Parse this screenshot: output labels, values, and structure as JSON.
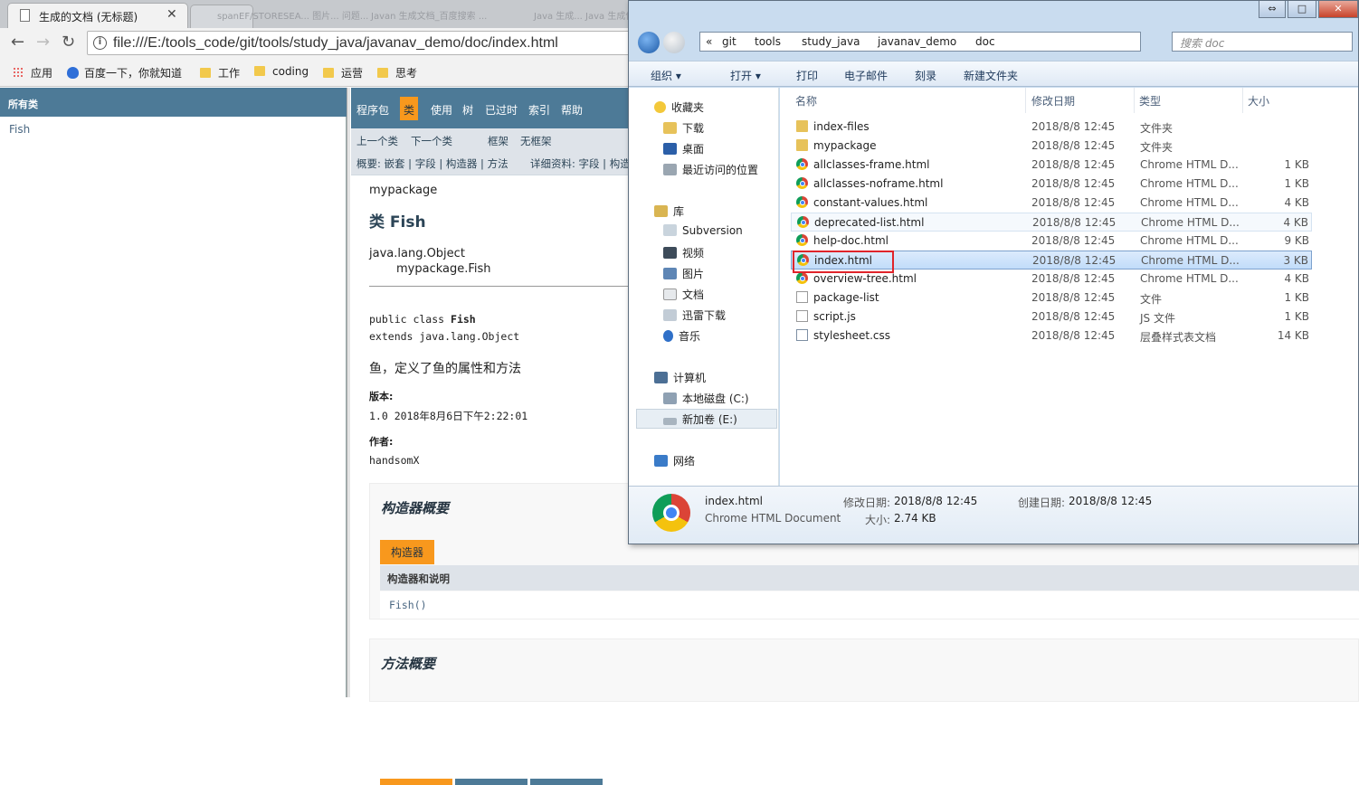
{
  "browser": {
    "tab_title": "生成的文档 (无标题)",
    "tab_close": "✕",
    "faint_tabs": [
      "spanEF/STORESEA... 图片... 问题...",
      "Javan 生成文档_百度搜索 ...",
      "Java 生成... Java 生成使用..."
    ],
    "url": "file:///E:/tools_code/git/tools/study_java/javanav_demo/doc/index.html",
    "bookmarks": [
      {
        "label": "应用",
        "icon": "apps-icon"
      },
      {
        "label": "百度一下，你就知道",
        "icon": "baidu-icon"
      },
      {
        "label": "工作",
        "icon": "folder-icon"
      },
      {
        "label": "coding",
        "icon": "folder-icon"
      },
      {
        "label": "运营",
        "icon": "folder-icon"
      },
      {
        "label": "思考",
        "icon": "folder-icon"
      }
    ]
  },
  "javadoc": {
    "left_header": "所有类",
    "left_classes": [
      "Fish"
    ],
    "nav": [
      "程序包",
      "类",
      "使用",
      "树",
      "已过时",
      "索引",
      "帮助"
    ],
    "active_nav": "类",
    "subnav_row1": [
      "上一个类",
      "下一个类",
      "框架",
      "无框架"
    ],
    "subnav_row2_left": "概要: 嵌套 | 字段 | 构造器 | 方法",
    "subnav_row2_right": "详细资料: 字段 | 构造",
    "package": "mypackage",
    "class_title": "类 Fish",
    "inherit_1": "java.lang.Object",
    "inherit_2": "mypackage.Fish",
    "decl_prefix": "public class ",
    "decl_name": "Fish",
    "decl_extends": "extends java.lang.Object",
    "description": "鱼，定义了鱼的属性和方法",
    "version_label": "版本:",
    "version_value": "1.0 2018年8月6日下午2:22:01",
    "author_label": "作者:",
    "author_value": "handsomX",
    "ctor_section_title": "构造器概要",
    "ctor_caption": "构造器",
    "ctor_table_header": "构造器和说明",
    "ctor_entry": "Fish()",
    "method_section_title": "方法概要"
  },
  "explorer": {
    "breadcrumbs": [
      "«",
      "git",
      "tools",
      "study_java",
      "javanav_demo",
      "doc"
    ],
    "search_placeholder": "搜索 doc",
    "commands": [
      "组织 ▾",
      "打开 ▾",
      "打印",
      "电子邮件",
      "刻录",
      "新建文件夹"
    ],
    "nav_pane": {
      "favorites": {
        "label": "收藏夹",
        "items": [
          "下载",
          "桌面",
          "最近访问的位置"
        ]
      },
      "libraries": {
        "label": "库",
        "items": [
          "Subversion",
          "视频",
          "图片",
          "文档",
          "迅雷下载",
          "音乐"
        ]
      },
      "computer": {
        "label": "计算机",
        "items": [
          "本地磁盘 (C:)",
          "新加卷 (E:)"
        ]
      },
      "network": {
        "label": "网络"
      }
    },
    "columns": [
      "名称",
      "修改日期",
      "类型",
      "大小"
    ],
    "files": [
      {
        "name": "index-files",
        "date": "2018/8/8 12:45",
        "type": "文件夹",
        "size": "",
        "icon": "folder-icon"
      },
      {
        "name": "mypackage",
        "date": "2018/8/8 12:45",
        "type": "文件夹",
        "size": "",
        "icon": "folder-icon"
      },
      {
        "name": "allclasses-frame.html",
        "date": "2018/8/8 12:45",
        "type": "Chrome HTML D...",
        "size": "1 KB",
        "icon": "chrome-icon"
      },
      {
        "name": "allclasses-noframe.html",
        "date": "2018/8/8 12:45",
        "type": "Chrome HTML D...",
        "size": "1 KB",
        "icon": "chrome-icon"
      },
      {
        "name": "constant-values.html",
        "date": "2018/8/8 12:45",
        "type": "Chrome HTML D...",
        "size": "4 KB",
        "icon": "chrome-icon"
      },
      {
        "name": "deprecated-list.html",
        "date": "2018/8/8 12:45",
        "type": "Chrome HTML D...",
        "size": "4 KB",
        "icon": "chrome-icon"
      },
      {
        "name": "help-doc.html",
        "date": "2018/8/8 12:45",
        "type": "Chrome HTML D...",
        "size": "9 KB",
        "icon": "chrome-icon"
      },
      {
        "name": "index.html",
        "date": "2018/8/8 12:45",
        "type": "Chrome HTML D...",
        "size": "3 KB",
        "icon": "chrome-icon"
      },
      {
        "name": "overview-tree.html",
        "date": "2018/8/8 12:45",
        "type": "Chrome HTML D...",
        "size": "4 KB",
        "icon": "chrome-icon"
      },
      {
        "name": "package-list",
        "date": "2018/8/8 12:45",
        "type": "文件",
        "size": "1 KB",
        "icon": "file-icon"
      },
      {
        "name": "script.js",
        "date": "2018/8/8 12:45",
        "type": "JS 文件",
        "size": "1 KB",
        "icon": "js-icon"
      },
      {
        "name": "stylesheet.css",
        "date": "2018/8/8 12:45",
        "type": "层叠样式表文档",
        "size": "14 KB",
        "icon": "css-icon"
      }
    ],
    "selected_file": "index.html",
    "details": {
      "name": "index.html",
      "type": "Chrome HTML Document",
      "modified_label": "修改日期:",
      "modified_value": "2018/8/8 12:45",
      "created_label": "创建日期:",
      "created_value": "2018/8/8 12:45",
      "size_label": "大小:",
      "size_value": "2.74 KB"
    }
  },
  "colors": {
    "javadoc_nav": "#4d7a97",
    "javadoc_accent": "#f8981d",
    "highlight_box": "#e0242a"
  }
}
